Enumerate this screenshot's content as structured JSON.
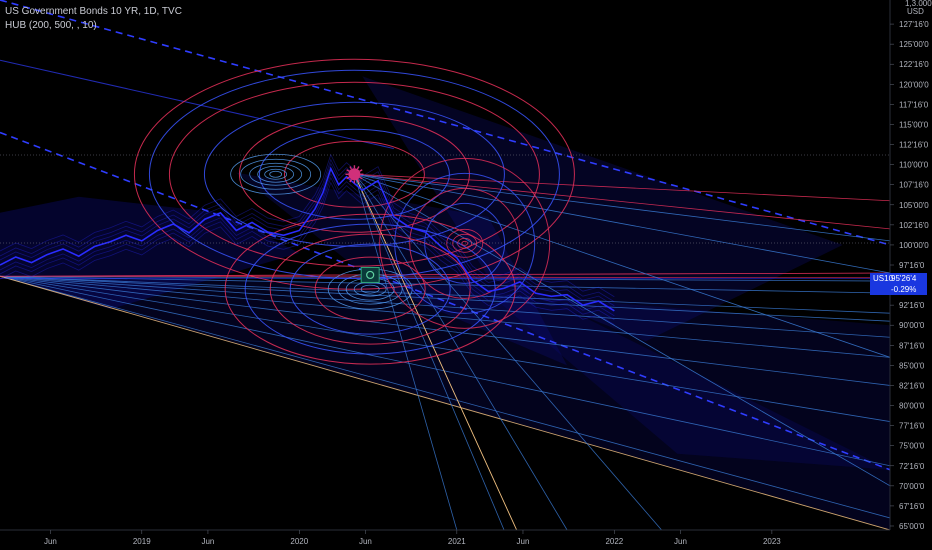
{
  "legend": {
    "title": "US Government Bonds 10 YR, 1D, TVC",
    "indicator": "HUB (200, 500, , 10)"
  },
  "price_axis": {
    "unit_top": "1,3.000",
    "currency": "USD"
  },
  "badge": {
    "symbol": "US10",
    "price": "95'26'4",
    "change": "-0.29%"
  },
  "colors": {
    "background": "#000000",
    "price_line": "#2a2cff",
    "fill": "#1010a0",
    "circle_red": "#e8305a",
    "circle_blue": "#3a55ff",
    "fan_line": "#3a7bd5",
    "trend_dashed": "#2f3dff",
    "badge": "#1a37e0",
    "lower_boundary": "#f0c080",
    "marker_icon": "#d0307a"
  },
  "chart_data": {
    "type": "line",
    "title": "US Government Bonds 10 YR, 1D, TVC",
    "symbol": "US10",
    "last_value": "95'26'4",
    "change_percent": "-0.29%",
    "y_tick_labels": [
      "127'16'0",
      "125'00'0",
      "122'16'0",
      "120'00'0",
      "117'16'0",
      "115'00'0",
      "112'16'0",
      "110'00'0",
      "107'16'0",
      "105'00'0",
      "102'16'0",
      "100'00'0",
      "97'16'0",
      "95'00'0",
      "92'16'0",
      "90'00'0",
      "87'16'0",
      "85'00'0",
      "82'16'0",
      "80'00'0",
      "77'16'0",
      "75'00'0",
      "72'16'0",
      "70'00'0",
      "67'16'0",
      "65'00'0"
    ],
    "y_tick_values": [
      127.5,
      125,
      122.5,
      120,
      117.5,
      115,
      112.5,
      110,
      107.5,
      105,
      102.5,
      100,
      97.5,
      95,
      92.5,
      90,
      87.5,
      85,
      82.5,
      80,
      77.5,
      75,
      72.5,
      70,
      67.5,
      65
    ],
    "x_tick_labels": [
      "Jun",
      "2019",
      "Jun",
      "2020",
      "Jun",
      "2021",
      "Jun",
      "2022",
      "Jun",
      "2023"
    ],
    "x_tick_years": [
      2018.42,
      2019.0,
      2019.42,
      2020.0,
      2020.42,
      2021.0,
      2021.42,
      2022.0,
      2022.42,
      2023.0
    ],
    "x_range": [
      2018.1,
      2023.75
    ],
    "ylim": [
      64.5,
      130.5
    ],
    "series": [
      {
        "x": [
          2018.1,
          2018.2,
          2018.3,
          2018.4,
          2018.5,
          2018.6,
          2018.7,
          2018.8,
          2018.9,
          2019.0,
          2019.1,
          2019.2,
          2019.3,
          2019.4,
          2019.5,
          2019.6,
          2019.7,
          2019.8,
          2019.9,
          2020.0,
          2020.1,
          2020.15,
          2020.2,
          2020.25,
          2020.3,
          2020.4,
          2020.5,
          2020.6,
          2020.7,
          2020.8,
          2020.9,
          2021.0,
          2021.1,
          2021.2,
          2021.3,
          2021.4,
          2021.5,
          2021.6,
          2021.7,
          2021.8,
          2021.9,
          2022.0
        ],
        "y": [
          97.5,
          98.5,
          97.8,
          98.8,
          99.5,
          98.6,
          99.8,
          100.4,
          101.2,
          100.5,
          101.8,
          102.6,
          101.5,
          103.2,
          104.0,
          101.8,
          102.8,
          101.6,
          101.2,
          101.8,
          104.5,
          106.5,
          109.5,
          107.5,
          108.5,
          106.8,
          108.0,
          103.5,
          102.2,
          101.6,
          99.8,
          98.4,
          95.6,
          94.2,
          94.6,
          95.4,
          94.0,
          93.6,
          93.8,
          92.5,
          93.0,
          91.8
        ]
      }
    ],
    "grid": false,
    "log_scale": false
  }
}
